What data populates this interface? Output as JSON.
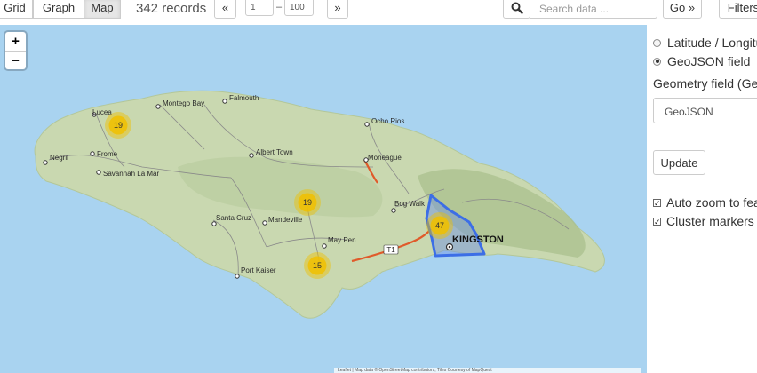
{
  "toolbar": {
    "views": [
      "Grid",
      "Graph",
      "Map"
    ],
    "active_view": "Map",
    "records": "342 records",
    "pager_prev": "«",
    "pager_from": "1",
    "pager_sep": "–",
    "pager_to": "100",
    "pager_next": "»",
    "search_placeholder": "Search data ...",
    "go_label": "Go »",
    "filters_label": "Filters"
  },
  "map": {
    "zoom_in": "+",
    "zoom_out": "−",
    "places": {
      "montego_bay": "Montego Bay",
      "falmouth": "Falmouth",
      "lucea": "Lucea",
      "negril": "Negril",
      "frome": "Frome",
      "savanna": "Savannah La Mar",
      "ocho_rios": "Ocho Rios",
      "albert_town": "Albert Town",
      "moneague": "Moneague",
      "bog_walk": "Bog Walk",
      "kingston": "KINGSTON",
      "santa_cruz": "Santa Cruz",
      "mandeville": "Mandeville",
      "may_pen": "May Pen",
      "port_kaiser": "Port Kaiser"
    },
    "route_shield": "T1",
    "clusters": [
      "19",
      "19",
      "47",
      "15"
    ],
    "attribution": "Leaflet | Map data © OpenStreetMap contributors, Tiles Courtesy of MapQuest"
  },
  "panel": {
    "option_latlon": "Latitude / Longitude fields",
    "option_geojson": "GeoJSON field",
    "selected_option": "GeoJSON field",
    "geometry_label": "Geometry field (GeoJSON)",
    "geometry_value": "GeoJSON",
    "update_label": "Update",
    "auto_zoom_label": "Auto zoom to features",
    "auto_zoom_checked": true,
    "cluster_label": "Cluster markers",
    "cluster_checked": true
  },
  "colors": {
    "sea": "#a9d3f0",
    "land": "#c9d8b0",
    "cluster": "#f0c000",
    "polygon": "#3c6ee6",
    "road_major": "#e05a2a"
  }
}
